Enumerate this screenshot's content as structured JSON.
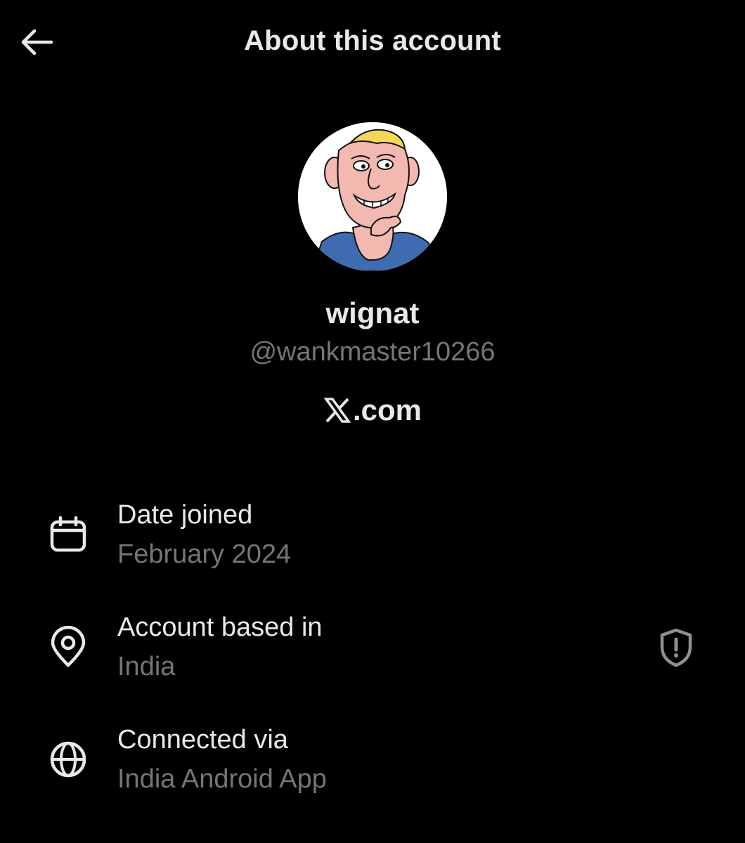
{
  "header": {
    "title": "About this account",
    "back_icon": "arrow-left-icon"
  },
  "profile": {
    "display_name": "wignat",
    "handle": "@wankmaster10266",
    "site_suffix": ".com",
    "site_logo": "x-logo-icon",
    "avatar_icon": "cartoon-avatar"
  },
  "info": [
    {
      "icon": "calendar-icon",
      "label": "Date joined",
      "value": "February 2024"
    },
    {
      "icon": "location-pin-icon",
      "label": "Account based in",
      "value": "India",
      "action_icon": "shield-alert-icon"
    },
    {
      "icon": "globe-icon",
      "label": "Connected via",
      "value": "India Android App"
    }
  ],
  "colors": {
    "background": "#000000",
    "primary_text": "#e7e9ea",
    "secondary_text": "#71767b"
  }
}
